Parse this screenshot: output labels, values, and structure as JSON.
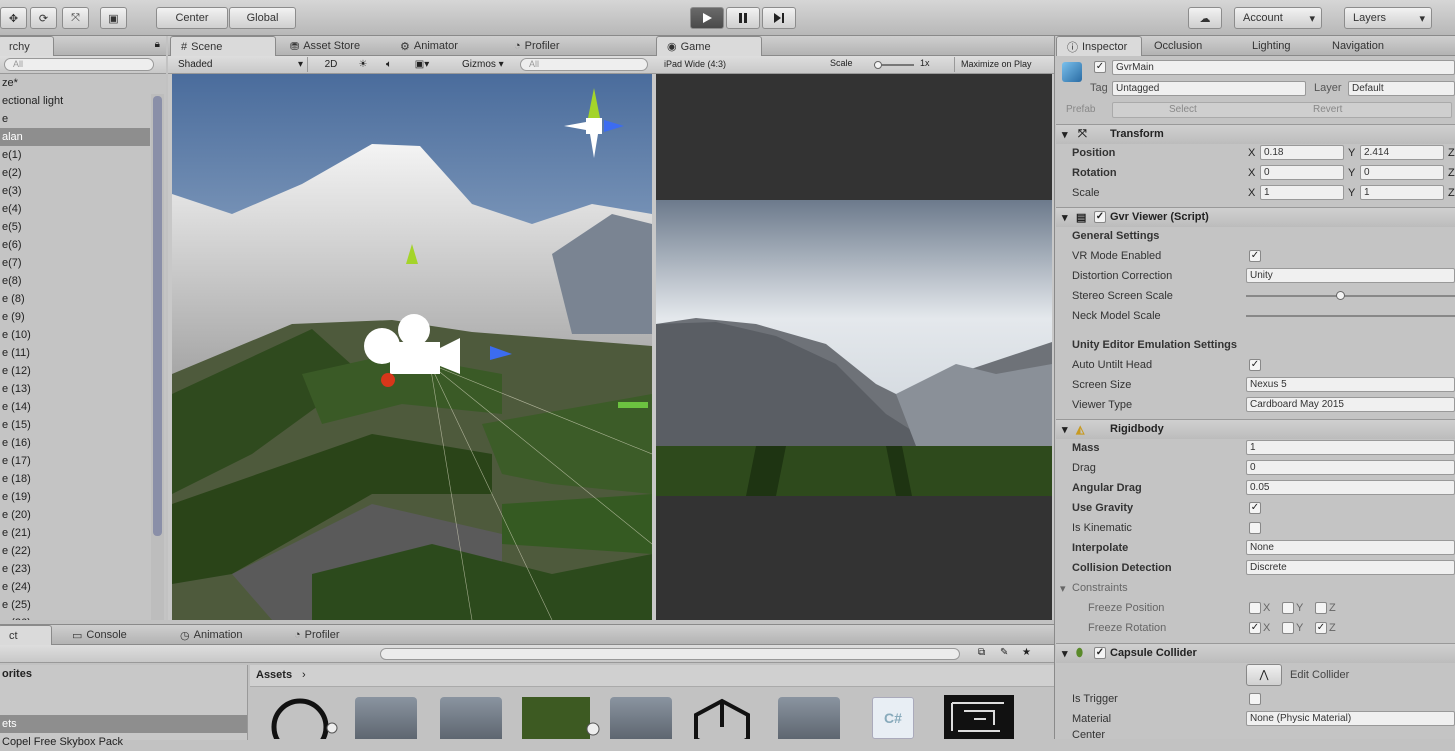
{
  "toolbar": {
    "center_label": "Center",
    "global_label": "Global",
    "account_label": "Account",
    "layers_label": "Layers"
  },
  "tabs": {
    "hierarchy": "rchy",
    "scene": "Scene",
    "asset_store": "Asset Store",
    "animator": "Animator",
    "profiler": "Profiler",
    "game": "Game",
    "inspector": "Inspector",
    "occlusion": "Occlusion",
    "lighting": "Lighting",
    "navigation": "Navigation"
  },
  "scene_bar": {
    "shaded": "Shaded",
    "twod": "2D",
    "gizmos": "Gizmos",
    "search_placeholder": "All"
  },
  "game_bar": {
    "aspect": "iPad Wide (4:3)",
    "scale": "Scale",
    "scale_value": "1x",
    "maximize": "Maximize on Play"
  },
  "hierarchy": {
    "search_placeholder": "All",
    "items": [
      "ze*",
      "ectional light",
      "e",
      "alan",
      "e(1)",
      "e(2)",
      "e(3)",
      "e(4)",
      "e(5)",
      "e(6)",
      "e(7)",
      "e(8)",
      "e (8)",
      "e (9)",
      "e (10)",
      "e (11)",
      "e (12)",
      "e (13)",
      "e (14)",
      "e (15)",
      "e (16)",
      "e (17)",
      "e (18)",
      "e (19)",
      "e (20)",
      "e (21)",
      "e (22)",
      "e (23)",
      "e (24)",
      "e (25)",
      "e (26)"
    ]
  },
  "inspector": {
    "object_name": "GvrMain",
    "tag_label": "Tag",
    "tag_value": "Untagged",
    "layer_label": "Layer",
    "layer_value": "Default",
    "prefab_label": "Prefab",
    "prefab_select": "Select",
    "prefab_revert": "Revert",
    "transform": {
      "title": "Transform",
      "position_label": "Position",
      "rotation_label": "Rotation",
      "scale_label": "Scale",
      "pos_x": "0.18",
      "pos_y": "2.414",
      "rot_x": "0",
      "rot_y": "0",
      "scale_x": "1",
      "scale_y": "1",
      "x": "X",
      "y": "Y",
      "z": "Z"
    },
    "gvr": {
      "title": "Gvr Viewer (Script)",
      "general_settings": "General Settings",
      "vr_mode": "VR Mode Enabled",
      "distortion": "Distortion Correction",
      "distortion_value": "Unity",
      "stereo_scale": "Stereo Screen Scale",
      "stereo_scale_fraction": 0.45,
      "neck_model": "Neck Model Scale",
      "editor_emulation": "Unity Editor Emulation Settings",
      "auto_untilt": "Auto Untilt Head",
      "screen_size": "Screen Size",
      "screen_size_value": "Nexus 5",
      "viewer_type": "Viewer Type",
      "viewer_type_value": "Cardboard May 2015"
    },
    "rigidbody": {
      "title": "Rigidbody",
      "mass": "Mass",
      "mass_value": "1",
      "drag": "Drag",
      "drag_value": "0",
      "angular_drag": "Angular Drag",
      "angular_drag_value": "0.05",
      "use_gravity": "Use Gravity",
      "is_kinematic": "Is Kinematic",
      "interpolate": "Interpolate",
      "interpolate_value": "None",
      "collision": "Collision Detection",
      "collision_value": "Discrete",
      "constraints": "Constraints",
      "freeze_position": "Freeze Position",
      "freeze_rotation": "Freeze Rotation",
      "x": "X",
      "y": "Y",
      "z": "Z"
    },
    "capsule": {
      "title": "Capsule Collider",
      "edit_collider": "Edit Collider",
      "is_trigger": "Is Trigger",
      "material": "Material",
      "material_value": "None (Physic Material)",
      "center": "Center"
    }
  },
  "bottom": {
    "project_tab": "ct",
    "console_tab": "Console",
    "animation_tab": "Animation",
    "profiler_tab": "Profiler",
    "favorites": "orites",
    "assets_item": "ets",
    "skybox_item": "Copel Free Skybox Pack",
    "assets_breadcrumb": "Assets",
    "cs_label": "C#"
  }
}
